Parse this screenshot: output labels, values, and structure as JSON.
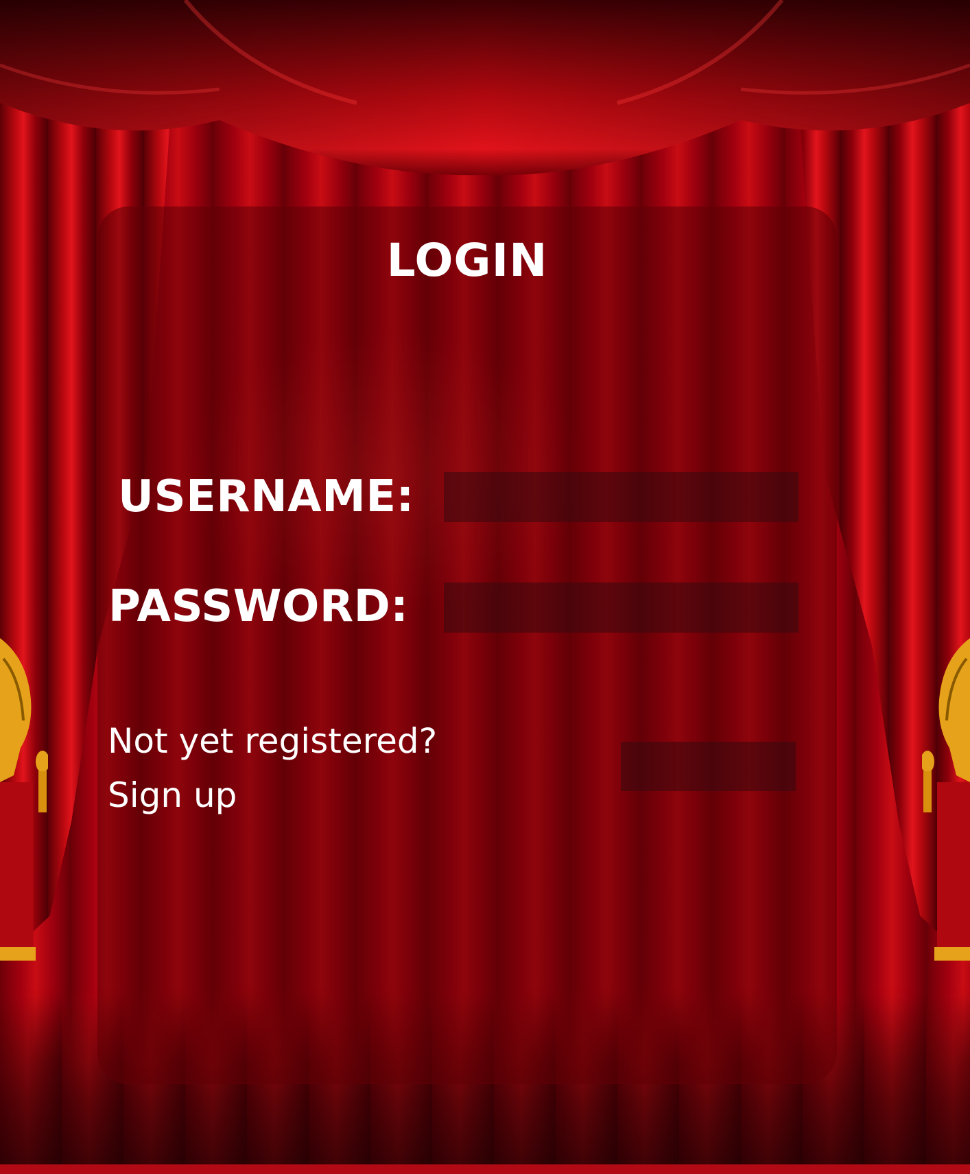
{
  "page": {
    "title": "LOGIN"
  },
  "form": {
    "username_label": "USERNAME:",
    "username_value": "",
    "password_label": "PASSWORD:",
    "password_value": "",
    "submit_label": ""
  },
  "register": {
    "prompt": "Not yet registered?",
    "link_label": "Sign up"
  },
  "theme": {
    "curtain_red": "#b8080f",
    "card_fill": "#5f0006",
    "field_fill": "#370a0e",
    "text_color": "#ffffff",
    "tassel_gold": "#e5a21a"
  }
}
